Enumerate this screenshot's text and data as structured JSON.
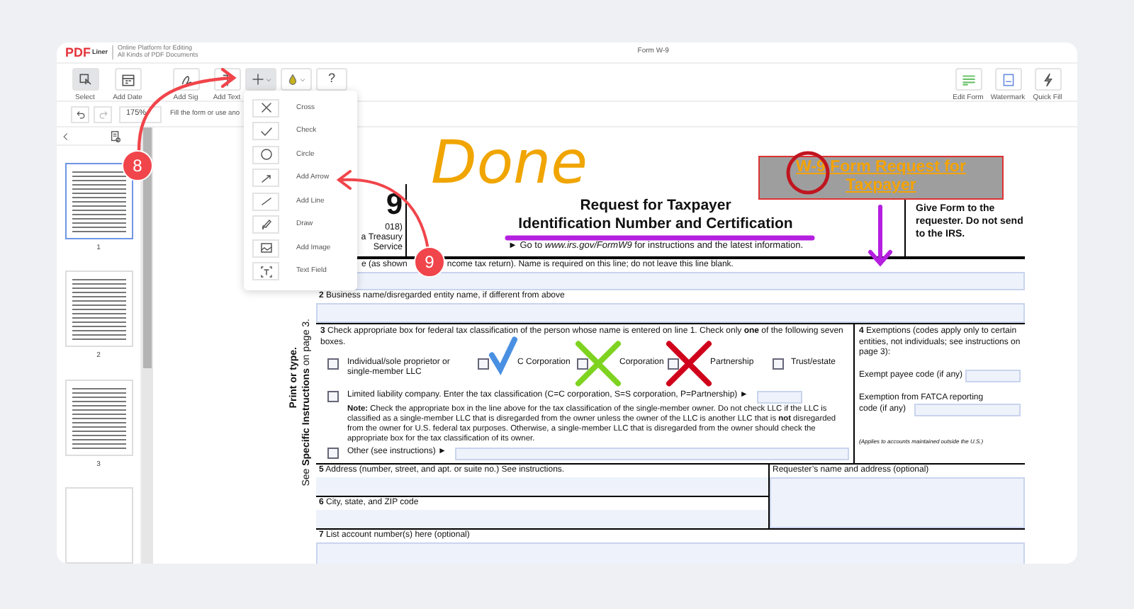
{
  "header": {
    "logo": "PDF",
    "logo_suffix": "Liner",
    "tagline": [
      "Online Platform for Editing",
      "All Kinds of PDF Documents"
    ],
    "document_title": "Form W-9"
  },
  "toolbar": {
    "tools": [
      {
        "kind": "tool",
        "label": "Select",
        "selected": true
      },
      {
        "kind": "tool",
        "label": "Add Date",
        "selected": false
      },
      {
        "kind": "tool",
        "label": "Add Sig",
        "selected": false
      },
      {
        "kind": "tool",
        "label": "Add Text",
        "selected": false
      },
      {
        "kind": "menu",
        "selected": true
      },
      {
        "kind": "menu",
        "selected": false
      },
      {
        "kind": "glyph",
        "text": "?",
        "selected": false
      }
    ],
    "right_tools": [
      {
        "label": "Edit Form"
      },
      {
        "label": "Watermark"
      },
      {
        "label": "Quick Fill"
      }
    ]
  },
  "subbar": {
    "zoom": "175%",
    "hint": "Fill the form or use ano"
  },
  "sidebar": {
    "pages": [
      {
        "kind": "page",
        "number": "1",
        "selected": true
      },
      {
        "kind": "page",
        "number": "2",
        "selected": false
      },
      {
        "kind": "page",
        "number": "3",
        "selected": false
      },
      {
        "kind": "blank",
        "selected": false
      }
    ]
  },
  "menu": {
    "items": [
      "Cross",
      "Check",
      "Circle",
      "Add Arrow",
      "Add Line",
      "Draw",
      "Add Image",
      "Text Field"
    ]
  },
  "form": {
    "left_header": [
      "9",
      "018)",
      "a Treasury",
      "Service"
    ],
    "title_lines": [
      "Request for Taxpayer",
      "Identification Number and Certification"
    ],
    "instruction": "► Go to *www.irs.gov/FormW9* for instructions and the latest information.",
    "send_note": "Give Form to the requester. Do not send to the IRS.",
    "side_notes": [
      "Print or type.",
      "See **Specific Instructions** on page 3."
    ],
    "line1_labels": [
      "e (as shown",
      "ncome tax return). Name is required on this line; do not leave this line blank."
    ],
    "line2_label": "**2** Business name/disregarded entity name, if different from above",
    "line3_label": "**3** Check appropriate box for federal tax classification of the person whose name is entered on line 1. Check only **one** of the following seven boxes.",
    "classifications": [
      {
        "label": "Individual/sole proprietor or single-member LLC",
        "checked": false
      },
      {
        "label": "C Corporation",
        "checked": false
      },
      {
        "label": "Corporation",
        "checked": false
      },
      {
        "label": "Partnership",
        "checked": false
      },
      {
        "label": "Trust/estate",
        "checked": false
      }
    ],
    "llc": {
      "label": "Limited liability company. Enter the tax classification (C=C corporation, S=S corporation, P=Partnership) ►",
      "checked": false
    },
    "note": "**Note:** Check the appropriate box in the line above for the tax classification of the single-member owner.  Do not check LLC if the LLC is classified as a single-member LLC that is disregarded from the owner unless the owner of the LLC is another LLC that is **not** disregarded from the owner for U.S. federal tax purposes. Otherwise, a single-member LLC that is disregarded from the owner should check the appropriate box for the tax classification of its owner.",
    "other": {
      "label": "Other (see instructions) ►",
      "checked": false
    },
    "exemptions": {
      "label": "**4** Exemptions (codes apply only to certain entities, not individuals; see instructions on page 3):",
      "payee_label": "Exempt payee code (if any)",
      "fatca_label": [
        "Exemption from FATCA reporting",
        "code (if any)"
      ],
      "footnote": "(Applies to accounts maintained outside the U.S.)"
    },
    "line5_label": "**5** Address (number, street, and apt. or suite no.) See instructions.",
    "line6_label": "**6** City, state, and ZIP code",
    "requester_label": "Requester’s name and address (optional)",
    "line7_label": "**7** List account number(s) here (optional)"
  },
  "annotations": {
    "callouts": [
      {
        "number": "8"
      },
      {
        "number": "9"
      }
    ],
    "handwriting": "Done",
    "highlight_box": "W-9 Form Request for Taxpayer",
    "marks": [
      {
        "kind": "check",
        "color": "#4a90e2"
      },
      {
        "kind": "cross",
        "color": "#7ed321"
      },
      {
        "kind": "cross",
        "color": "#d0021b"
      }
    ]
  }
}
